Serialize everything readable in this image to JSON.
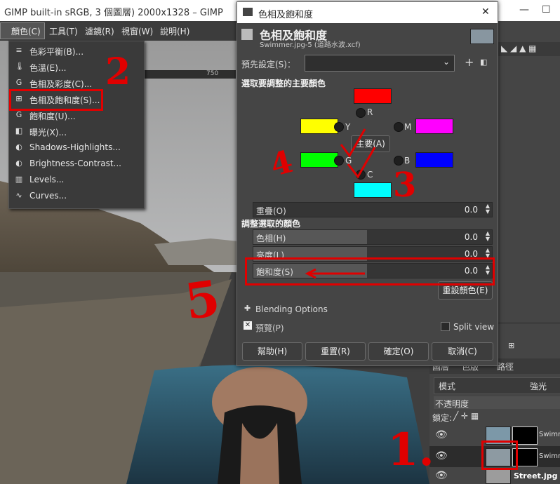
{
  "window": {
    "title": "GIMP built-in sRGB, 3 個圖層) 2000x1328 – GIMP",
    "minimize": "—",
    "maximize": "☐"
  },
  "menubar": [
    {
      "label": "顏色(C)"
    },
    {
      "label": "工具(T)"
    },
    {
      "label": "濾鏡(R)"
    },
    {
      "label": "視窗(W)"
    },
    {
      "label": "說明(H)"
    },
    {
      "label": "»"
    }
  ],
  "ruler": {
    "label": "750"
  },
  "colors_menu": [
    {
      "label": "色彩平衡(B)...",
      "icon": "≡"
    },
    {
      "label": "色溫(E)...",
      "icon": "🌡"
    },
    {
      "label": "色相及彩度(C)...",
      "icon": "G"
    },
    {
      "label": "色相及飽和度(S)...",
      "icon": "⊞"
    },
    {
      "label": "飽和度(U)...",
      "icon": "G"
    },
    {
      "label": "曝光(X)...",
      "icon": "◧"
    },
    {
      "label": "Shadows-Highlights...",
      "icon": "◐"
    },
    {
      "label": "Brightness-Contrast...",
      "icon": "◐"
    },
    {
      "label": "Levels...",
      "icon": "▥"
    },
    {
      "label": "Curves...",
      "icon": "∿"
    }
  ],
  "dialog": {
    "title": "色相及飽和度",
    "close": "✕",
    "header": "色相及飽和度",
    "subheader": "Swimmer.jpg-5 (道路水波.xcf)",
    "preset_label": "預先設定(S)：",
    "preset_value": "",
    "section1": "選取要調整的主要顏色",
    "colors": [
      {
        "label": "R",
        "hex": "#ff0000"
      },
      {
        "label": "Y",
        "hex": "#ffff00"
      },
      {
        "label": "M",
        "hex": "#ff00ff"
      },
      {
        "label": "G",
        "hex": "#00ff00"
      },
      {
        "label": "B",
        "hex": "#0000ff"
      },
      {
        "label": "C",
        "hex": "#00ffff"
      }
    ],
    "master_label": "主要(A)",
    "overlap": {
      "label": "重疊(O)",
      "value": "0.0"
    },
    "section2": "調整選取的顏色",
    "hue": {
      "label": "色相(H)",
      "value": "0.0"
    },
    "lightness": {
      "label": "亮度(L)",
      "value": "0.0"
    },
    "saturation": {
      "label": "飽和度(S)",
      "value": "0.0"
    },
    "reset_color": "重設顏色(E)",
    "blending": "Blending Options",
    "preview": "預覽(P)",
    "split_view": "Split view",
    "buttons": {
      "help": "幫助(H)",
      "reset": "重置(R)",
      "ok": "確定(O)",
      "cancel": "取消(C)"
    }
  },
  "right_panel": {
    "tabs": [
      "圖層",
      "色版",
      "路徑"
    ],
    "mode_label": "模式",
    "mode_value": "強光",
    "opacity_label": "不透明度",
    "lock_label": "鎖定:",
    "layers": [
      {
        "name": "Swimmer"
      },
      {
        "name": "Swimmer"
      },
      {
        "name": "Street.jpg"
      }
    ]
  },
  "annotations": [
    "2",
    "4",
    "3",
    "5",
    "1."
  ],
  "accent_color": "#e00000"
}
